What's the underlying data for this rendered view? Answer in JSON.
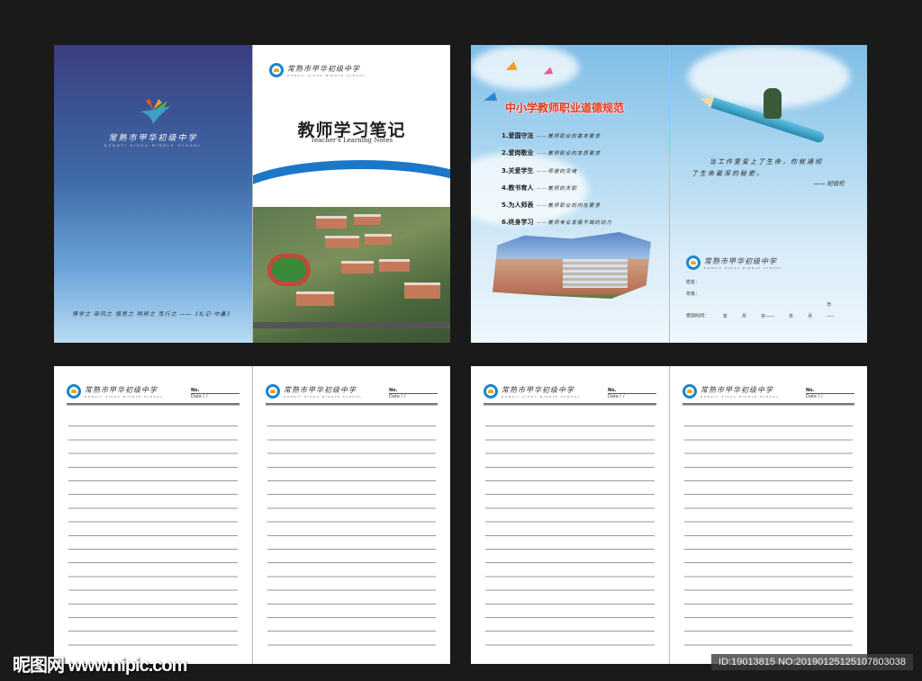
{
  "school": {
    "name_cn": "常熟市甲华初级中学",
    "name_en": "DONGYI ZIHUA MIDDLE SCHOOL"
  },
  "back_cover": {
    "quote": "博学之 审问之 慎思之 明辨之 笃行之 ——《礼记·中庸》"
  },
  "front_cover": {
    "title": "教师学习笔记",
    "subtitle": "Teacher's Learning Notes"
  },
  "inside_left": {
    "heading": "中小学教师职业道德规范",
    "items": [
      {
        "key": "1.爱国守法",
        "desc": "——教师职业的基本要求"
      },
      {
        "key": "2.爱岗敬业",
        "desc": "——教师职业的本质要求"
      },
      {
        "key": "3.关爱学生",
        "desc": "——师德的灵魂"
      },
      {
        "key": "4.教书育人",
        "desc": "——教师的天职"
      },
      {
        "key": "5.为人师表",
        "desc": "——教师职业的内在要求"
      },
      {
        "key": "6.终身学习",
        "desc": "——教师专业发展不竭的动力"
      }
    ]
  },
  "inside_right": {
    "poem_line1": "当工作里爱上了生命，你就通彻",
    "poem_line2": "了生命最深的秘密。",
    "author": "—— 纪伯伦",
    "name_label": "姓名：",
    "grade_label": "年级：",
    "period_label": "使用时间：",
    "year": "年",
    "month": "月",
    "day": "日——"
  },
  "note_page": {
    "no_label": "No.",
    "date_label": "Date    /    /"
  },
  "watermark": {
    "site": "昵图网 www.nipic.com",
    "id": "ID:19013815 NO:20190125125107803038"
  }
}
